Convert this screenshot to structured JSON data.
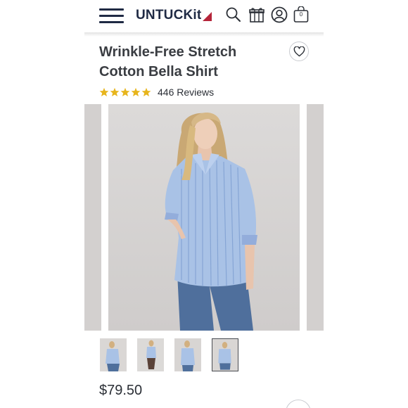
{
  "header": {
    "logo_text": "UNTUCKit",
    "cart_count": "0",
    "icons": [
      "menu-icon",
      "search-icon",
      "gift-icon",
      "account-icon",
      "cart-icon"
    ]
  },
  "product": {
    "title": "Wrinkle-Free Stretch Cotton Bella Shirt",
    "rating": 5,
    "reviews_text": "446 Reviews",
    "price": "$79.50"
  },
  "gallery": {
    "thumbnails": 4,
    "active_index": 3
  },
  "colors": {
    "brand_navy": "#1f2a44",
    "brand_red": "#b5253a",
    "star_gold": "#e7b51d",
    "shirt_blue": "#a9c2e6",
    "jeans": "#4f6f9c"
  }
}
